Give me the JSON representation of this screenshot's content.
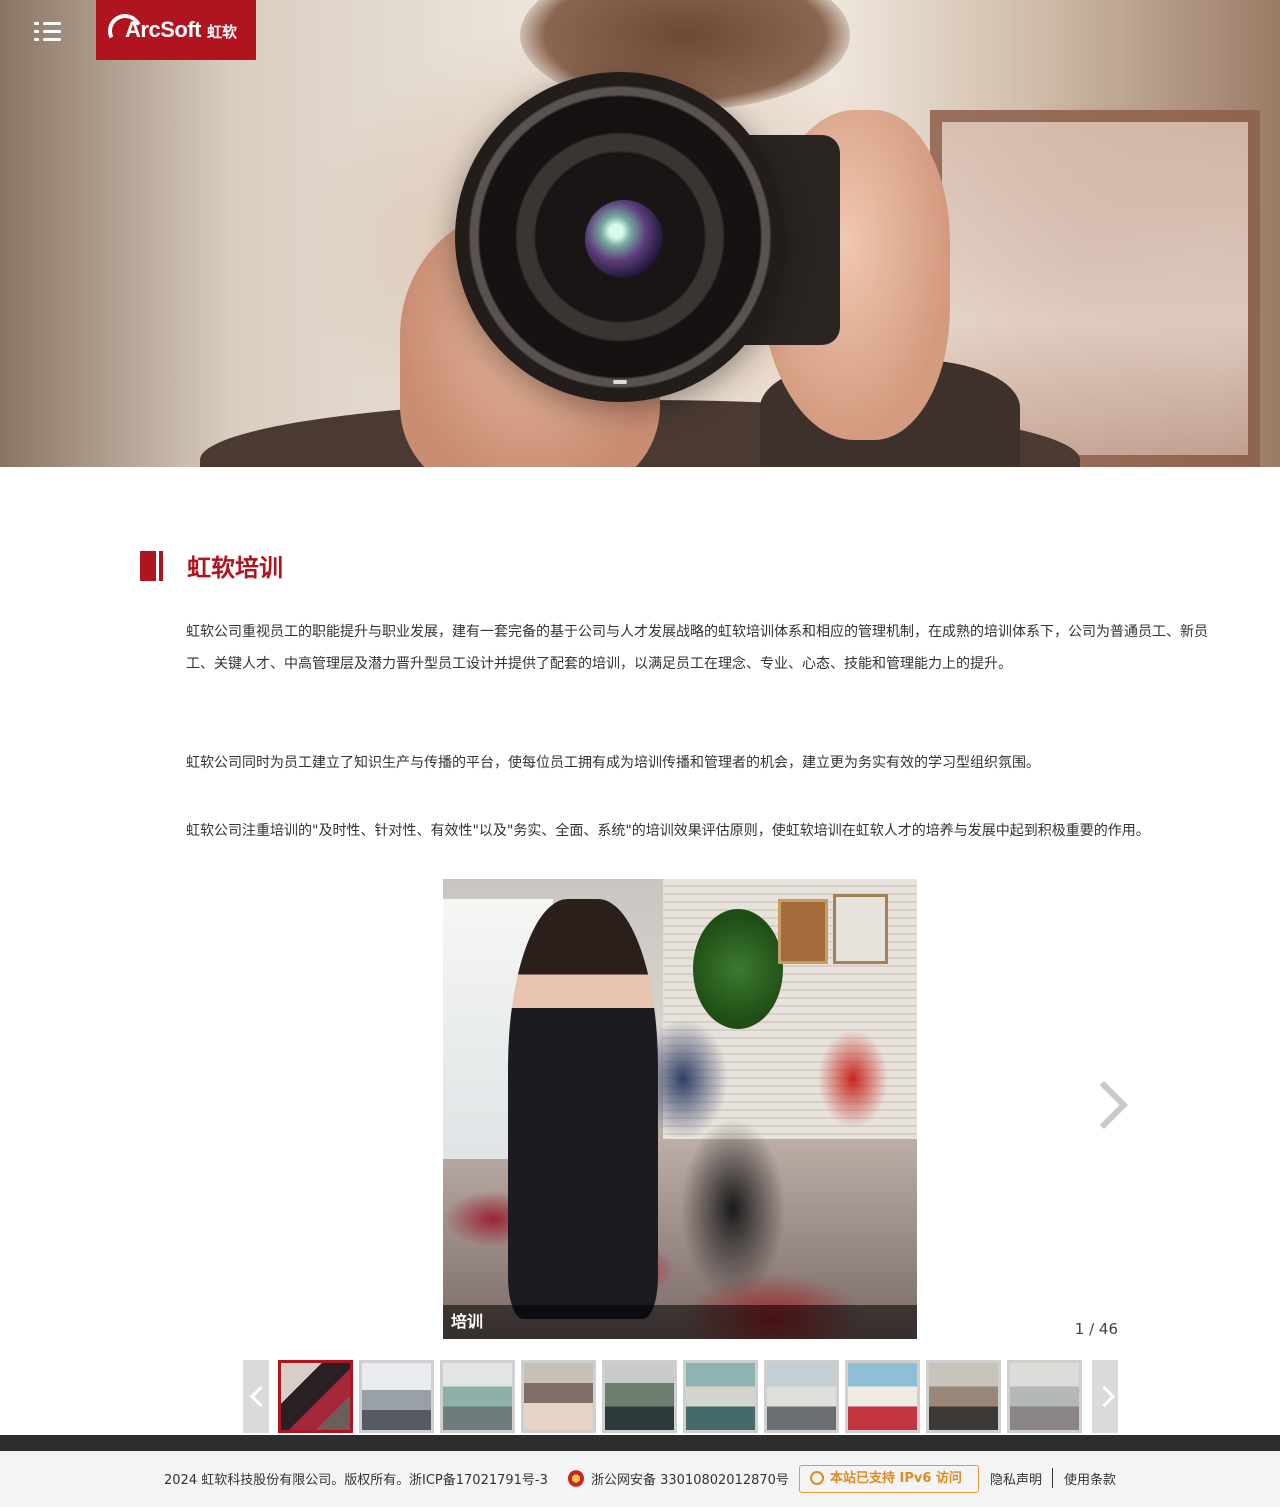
{
  "header": {
    "logo_brand": "ArcSoft",
    "logo_cn": "虹软"
  },
  "section": {
    "title": "虹软培训",
    "paragraphs": [
      "虹软公司重视员工的职能提升与职业发展，建有一套完备的基于公司与人才发展战略的虹软培训体系和相应的管理机制，在成熟的培训体系下，公司为普通员工、新员工、关键人才、中高管理层及潜力晋升型员工设计并提供了配套的培训，以满足员工在理念、专业、心态、技能和管理能力上的提升。",
      "虹软公司同时为员工建立了知识生产与传播的平台，使每位员工拥有成为培训传播和管理者的机会，建立更为务实有效的学习型组织氛围。",
      "虹软公司注重培训的\"及时性、针对性、有效性\"以及\"务实、全面、系统\"的培训效果评估原则，使虹软培训在虹软人才的培养与发展中起到积极重要的作用。"
    ]
  },
  "gallery": {
    "caption": "培训",
    "counter": "1 / 46",
    "current": 1,
    "total": 46,
    "thumbnail_count": 10,
    "active_thumbnail": 0
  },
  "footer": {
    "copyright": "2024 虹软科技股份有限公司。版权所有。",
    "icp": "浙ICP备17021791号-3",
    "police": "浙公网安备 33010802012870号",
    "ipv6": "本站已支持 IPv6 访问",
    "privacy": "隐私声明",
    "terms": "使用条款"
  },
  "colors": {
    "brand_red": "#b0141f",
    "ipv6_orange": "#e08a20",
    "footer_bg": "#f4f4f4"
  },
  "icons": [
    "menu-icon",
    "next-arrow-icon",
    "prev-arrow-icon",
    "police-badge-icon",
    "ribbon-icon"
  ]
}
